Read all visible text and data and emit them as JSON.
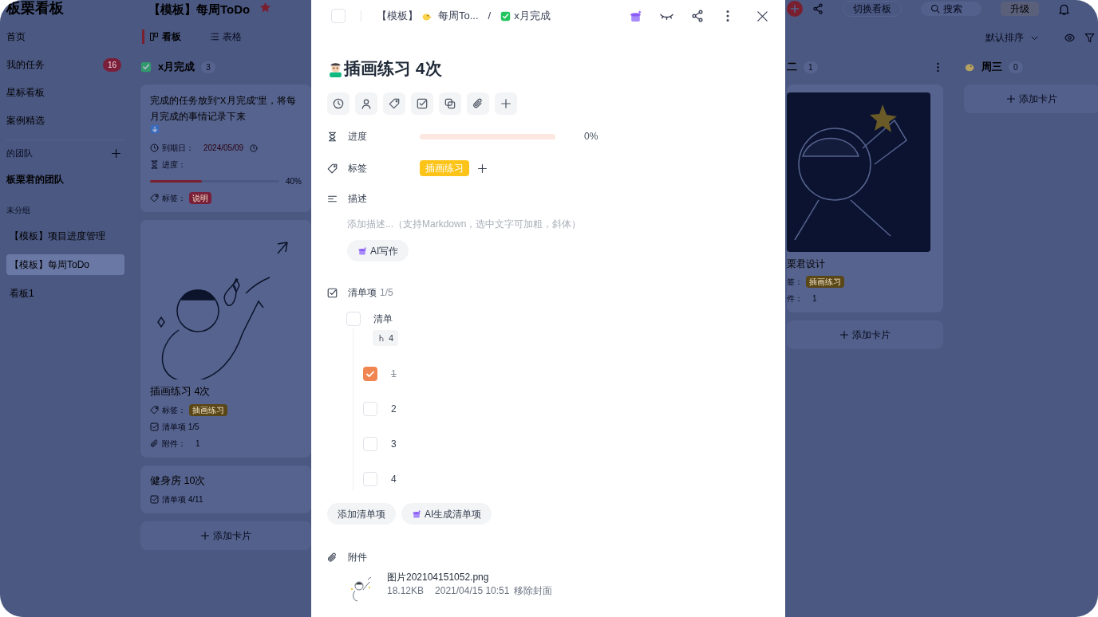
{
  "sidebar": {
    "title": "板栗看板",
    "nav": [
      {
        "label": "首页"
      },
      {
        "label": "我的任务",
        "badge": "16"
      },
      {
        "label": "星标看板"
      },
      {
        "label": "案例精选"
      }
    ],
    "team_heading": "的团队",
    "team": "板栗君的团队",
    "group_heading": "未分组",
    "boards": [
      {
        "label": "【模板】项目进度管理",
        "selected": false
      },
      {
        "label": "【模板】每周ToDo",
        "selected": true
      },
      {
        "label": "看板1",
        "selected": false
      }
    ]
  },
  "header": {
    "board_title": "【模板】每周ToDo",
    "switch_button": "切换看板",
    "search": {
      "placeholder": "搜索"
    },
    "upgrade_button": "升级",
    "views": [
      {
        "label": "看板",
        "selected": true
      },
      {
        "label": "表格",
        "selected": false
      }
    ],
    "sort": "默认排序"
  },
  "columns": [
    {
      "title": "x月完成",
      "count": "3",
      "cards": [
        {
          "kind": "note",
          "text": "完成的任务放到“X月完成”里，将每月完成的事情记录下来",
          "due_label": "到期日：",
          "due": "2024/05/09",
          "progress_label": "进度：",
          "level": 0.4,
          "progress": "40%",
          "tags_label": "标签：",
          "tags": [
            {
              "label": "说明",
              "color": "#7a1f3a"
            }
          ]
        },
        {
          "kind": "image",
          "title": "插画练习 4次",
          "tags_label": "标签：",
          "tags": [
            {
              "label": "插画练习",
              "color": "#5a4718"
            }
          ],
          "checklist": "清单项 1/5",
          "attachments_label": "附件：",
          "attachments": "1"
        },
        {
          "kind": "plain",
          "title": "健身房 10次",
          "checklist": "清单项 4/11"
        }
      ],
      "add": "添加卡片"
    },
    {
      "title": "二",
      "count": "1",
      "cards": [
        {
          "kind": "cover",
          "title": "栗君设计",
          "tags_label": "签：",
          "tags": [
            {
              "label": "插画练习",
              "color": "#5a4718"
            }
          ],
          "attachments_label": "件：",
          "attachments": "1"
        }
      ],
      "add": "添加卡片"
    },
    {
      "title": "周三",
      "count": "0",
      "add": "添加卡片"
    }
  ],
  "modal": {
    "done": false,
    "breadcrumb": {
      "items": [
        "【模板】",
        "每周To...",
        "x月完成"
      ],
      "separator": "/"
    },
    "title": "插画练习 4次",
    "progress": {
      "label": "进度",
      "level": 0,
      "reading": "0%"
    },
    "tags": {
      "label": "标签",
      "items": [
        {
          "label": "插画练习",
          "color": "#fcc419"
        }
      ]
    },
    "description": {
      "label": "描述",
      "placeholder": "添加描述...（支持Markdown，选中文字可加粗，斜体）",
      "ai_button": "AI写作"
    },
    "checklist": {
      "label": "清单项",
      "count": "1/5",
      "items": [
        {
          "label": "清单",
          "checked": false,
          "subtask_count": "4",
          "children": [
            {
              "label": "1",
              "checked": true
            },
            {
              "label": "2",
              "checked": false
            },
            {
              "label": "3",
              "checked": false
            },
            {
              "label": "4",
              "checked": false
            }
          ]
        }
      ]
    },
    "checklist_buttons": [
      "添加清单项",
      "AI生成清单项"
    ],
    "attachments": {
      "label": "附件",
      "files": [
        {
          "name": "图片202104151052.png",
          "size": "18.12KB",
          "date": "2021/04/15 10:51",
          "action": "移除封面"
        }
      ]
    }
  }
}
